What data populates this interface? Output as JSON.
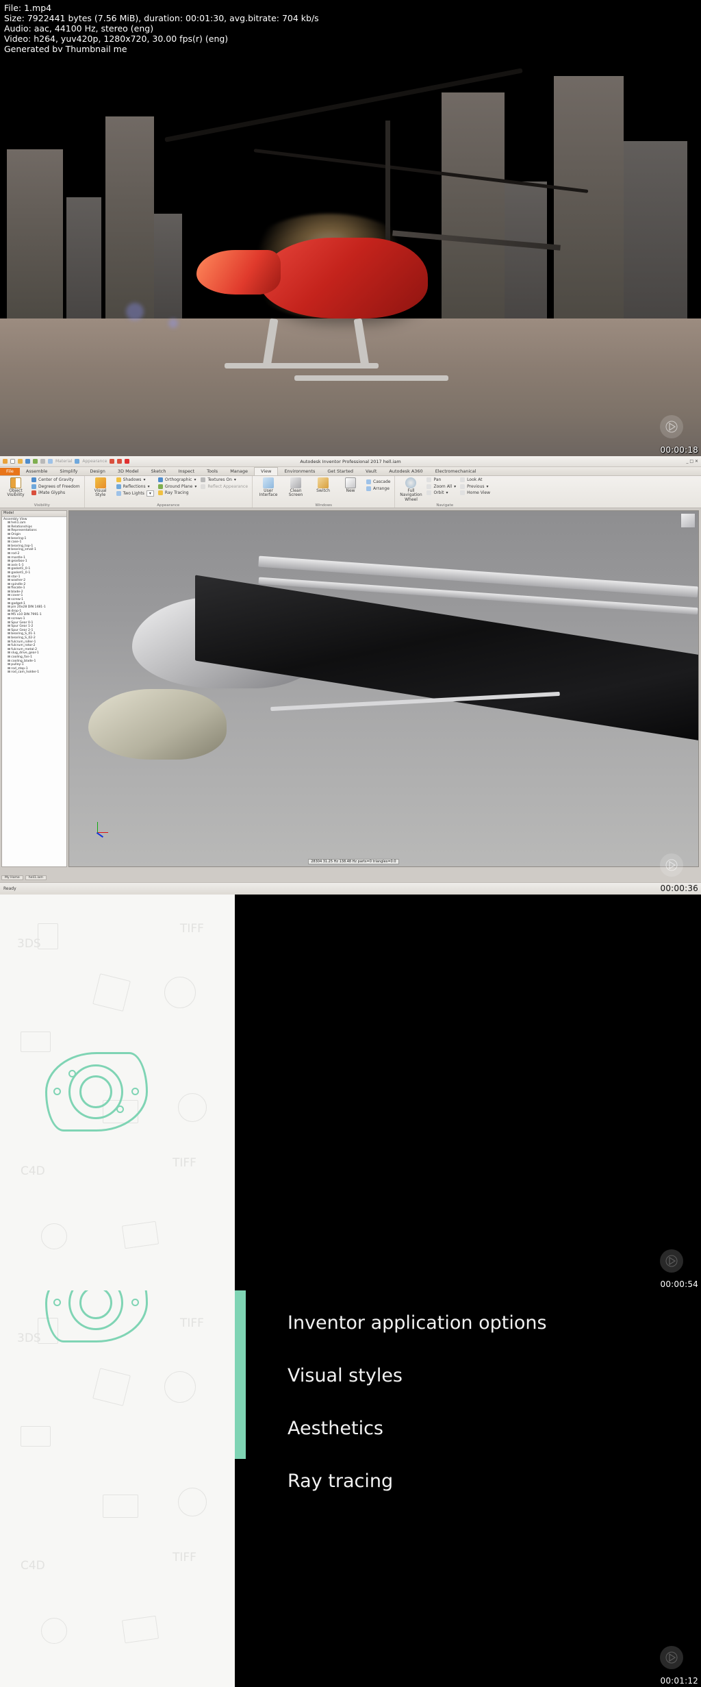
{
  "header": {
    "lines": [
      "File: 1.mp4",
      "Size: 7922441 bytes (7.56 MiB), duration: 00:01:30, avg.bitrate: 704 kb/s",
      "Audio: aac, 44100 Hz, stereo (eng)",
      "Video: h264, yuv420p, 1280x720, 30.00 fps(r) (eng)",
      "Generated by Thumbnail me"
    ]
  },
  "thumbnails": [
    {
      "index": 1,
      "timestamp": "00:00:18",
      "caption": "helicopter-render"
    },
    {
      "index": 2,
      "timestamp": "00:00:36",
      "caption": "autodesk-inventor-screencast"
    },
    {
      "index": 3,
      "timestamp": "00:00:54",
      "caption": "title-slide-blank"
    },
    {
      "index": 4,
      "timestamp": "00:01:12",
      "caption": "agenda-slide"
    }
  ],
  "inventor": {
    "title": "Autodesk Inventor Professional 2017   hell.iam",
    "quick_access": [
      "new",
      "open",
      "save",
      "undo",
      "redo",
      "home",
      "update",
      "material-swatch",
      "appearance-swatch"
    ],
    "material_value": "Material",
    "appearance_value": "Appearance",
    "tabs": [
      "File",
      "Assemble",
      "Simplify",
      "Design",
      "3D Model",
      "Sketch",
      "Inspect",
      "Tools",
      "Manage",
      "View",
      "Environments",
      "Get Started",
      "Vault",
      "Autodesk A360",
      "Electromechanical"
    ],
    "active_tab": "View",
    "ribbon_groups": [
      {
        "name": "Visibility",
        "big": [
          {
            "label": "Object Visibility"
          }
        ],
        "items": [
          "Center of Gravity",
          "Degrees of Freedom",
          "iMate Glyphs"
        ]
      },
      {
        "name": "Appearance",
        "big": [
          {
            "label": "Visual Style"
          }
        ],
        "items": [
          "Shadows",
          "Reflections",
          "Two Lights",
          "Orthographic",
          "Ground Plane",
          "Ray Tracing",
          "Textures On",
          "Reflect Appearance"
        ]
      },
      {
        "name": "Windows",
        "big": [
          {
            "label": "User Interface"
          },
          {
            "label": "Clean Screen"
          },
          {
            "label": "Switch"
          },
          {
            "label": "New"
          }
        ],
        "items": [
          "Cascade",
          "Arrange"
        ]
      },
      {
        "name": "Navigate",
        "big": [
          {
            "label": "Full Navigation Wheel"
          }
        ],
        "items": [
          "Pan",
          "Zoom All",
          "Orbit",
          "Look At",
          "Previous",
          "Home View"
        ]
      }
    ],
    "browser_title": "Model",
    "browser_root": "Assembly View",
    "tree_items": [
      "heli1.iam",
      "Relationships",
      "Representations",
      "Origin",
      "bearing-1",
      "case-1",
      "bearing_top-1",
      "bearing_small-1",
      "rod-2",
      "mantle-1",
      "gearbox-1",
      "axis-1-1",
      "gasket1_0-1",
      "gasket1_0-1",
      "star-1",
      "washer-2",
      "spindle-2",
      "flocate-1",
      "blade-2",
      "cover-1",
      "screw-1",
      "gadget-1",
      "pin 20x28 DIN 1481-1",
      "drop-1",
      "M5 x10 DIN 7991-1",
      "screws-1",
      "Spur Gear 0-1",
      "Spur Gear 1-2",
      "Spur Gear 2-1",
      "bearing_S_01-1",
      "bearing_S_02-2",
      "fulcrum_roller-1",
      "fulcrum_rotor-2",
      "fulcrum_metal-2",
      "slug_drive_gear-1",
      "cooling_fan-1",
      "cooling_blade-1",
      "pulley-1",
      "rod_step-1",
      "rod_cam_holder-1"
    ],
    "status_left": "Ready",
    "viewport_stats": "28304  31.25 Hz 138.48 Hz  parts=0 triangles=0:0",
    "doc_tabs": [
      "My Home",
      "heli1.iam"
    ]
  },
  "slide": {
    "items": [
      "Inventor application options",
      "Visual styles",
      "Aesthetics",
      "Ray tracing"
    ],
    "accent_color": "#7fd4b4",
    "background_color": "#000000",
    "pattern_color": "#e3e3e1",
    "pattern_glyphs": [
      "3DS",
      "TIFF",
      "C4D",
      "TIFF",
      "3DS",
      "C4D",
      "TIFF"
    ]
  }
}
